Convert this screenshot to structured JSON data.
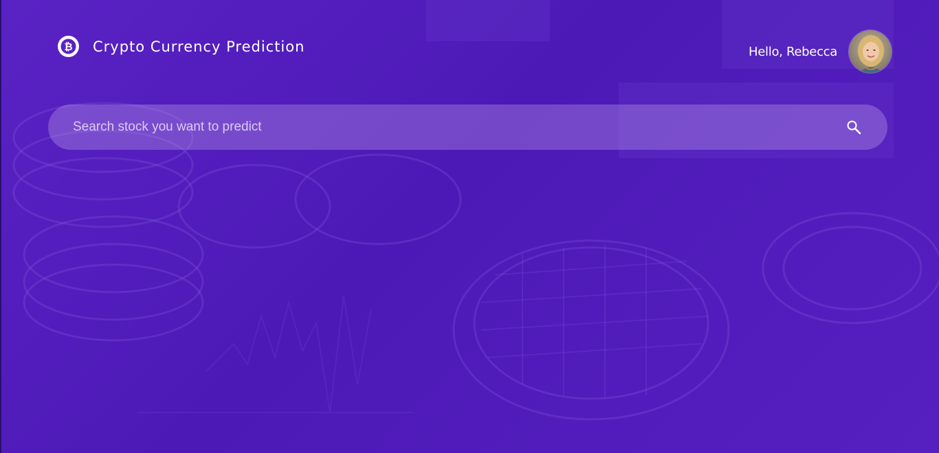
{
  "header": {
    "app_title": "Crypto Currency Prediction",
    "logo_icon": "bitcoin-icon",
    "greeting": "Hello, Rebecca",
    "avatar_icon": "user-avatar"
  },
  "search": {
    "placeholder": "Search stock you want to predict",
    "value": "",
    "icon": "search-icon"
  },
  "colors": {
    "background": "#4f1cbb",
    "search_bar": "#8a5fd0",
    "text": "#ffffff"
  }
}
